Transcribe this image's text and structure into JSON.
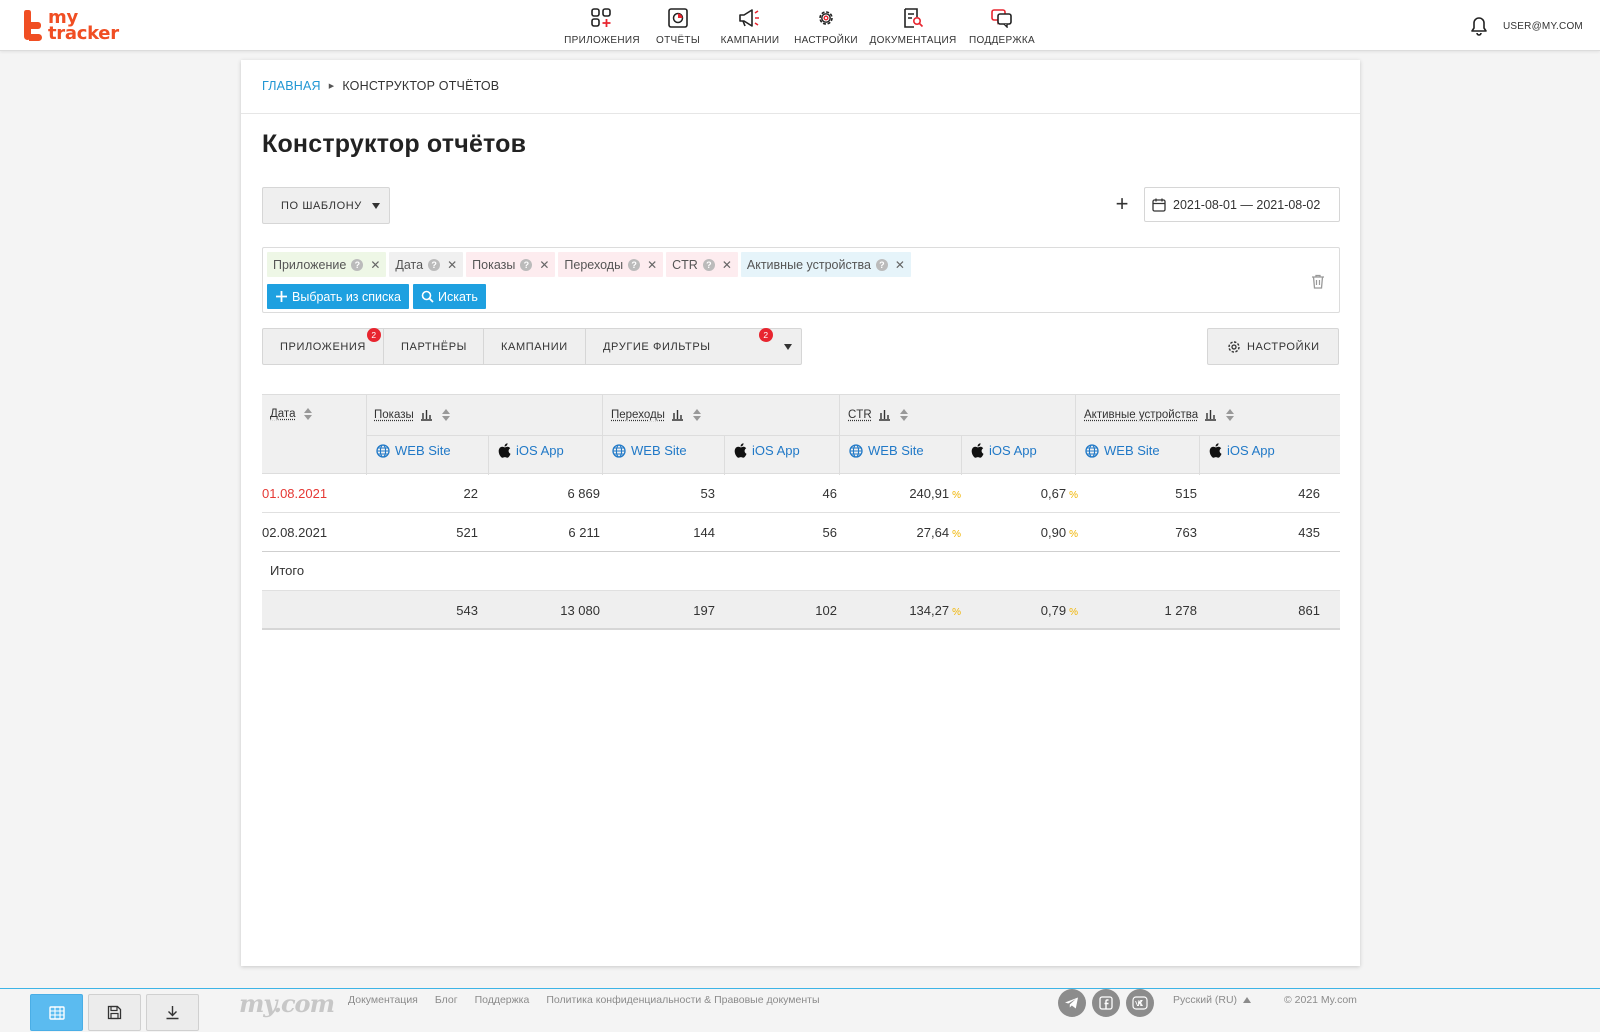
{
  "brand": {
    "line1": "my",
    "line2": "tracker"
  },
  "nav": [
    {
      "label": "ПРИЛОЖЕНИЯ",
      "icon": "apps-icon"
    },
    {
      "label": "ОТЧЁТЫ",
      "icon": "reports-icon"
    },
    {
      "label": "КАМПАНИИ",
      "icon": "megaphone-icon"
    },
    {
      "label": "НАСТРОЙКИ",
      "icon": "gear-icon"
    },
    {
      "label": "ДОКУМЕНТАЦИЯ",
      "icon": "document-search-icon"
    },
    {
      "label": "ПОДДЕРЖКА",
      "icon": "chat-icon"
    }
  ],
  "user": {
    "email": "USER@MY.COM"
  },
  "breadcrumb": {
    "home": "ГЛАВНАЯ",
    "current": "КОНСТРУКТОР ОТЧЁТОВ"
  },
  "page": {
    "title": "Конструктор отчётов"
  },
  "template_button": {
    "label": "ПО ШАБЛОНУ"
  },
  "date_range": {
    "value": "2021-08-01 — 2021-08-02"
  },
  "metrics": {
    "chips": [
      {
        "label": "Приложение",
        "color": "#eef7e6"
      },
      {
        "label": "Дата",
        "color": "#f0f0f0"
      },
      {
        "label": "Показы",
        "color": "#fdecef"
      },
      {
        "label": "Переходы",
        "color": "#fdecef"
      },
      {
        "label": "CTR",
        "color": "#fdecef"
      },
      {
        "label": "Активные устройства",
        "color": "#e6f4fa"
      }
    ],
    "choose_label": "Выбрать из списка",
    "search_label": "Искать"
  },
  "filters": [
    {
      "label": "ПРИЛОЖЕНИЯ",
      "badge": "2"
    },
    {
      "label": "ПАРТНЁРЫ",
      "badge": ""
    },
    {
      "label": "КАМПАНИИ",
      "badge": ""
    },
    {
      "label": "ДРУГИЕ ФИЛЬТРЫ",
      "badge": "2"
    }
  ],
  "settings_button": {
    "label": "НАСТРОЙКИ"
  },
  "table": {
    "date_header": "Дата",
    "groups": [
      "Показы",
      "Переходы",
      "CTR",
      "Активные устройства"
    ],
    "subcolumns": [
      "WEB Site",
      "iOS App"
    ],
    "percent_sign": "%",
    "rows": [
      {
        "date": "01.08.2021",
        "highlight": true,
        "values": [
          "22",
          "6 869",
          "53",
          "46",
          "240,91",
          "0,67",
          "515",
          "426"
        ]
      },
      {
        "date": "02.08.2021",
        "highlight": false,
        "values": [
          "521",
          "6 211",
          "144",
          "56",
          "27,64",
          "0,90",
          "763",
          "435"
        ]
      }
    ],
    "total_label": "Итого",
    "totals": [
      "543",
      "13 080",
      "197",
      "102",
      "134,27",
      "0,79",
      "1 278",
      "861"
    ]
  },
  "footer": {
    "logo": "my.com",
    "links": [
      "Документация",
      "Блог",
      "Поддержка",
      "Политика конфиденциальности & Правовые документы"
    ],
    "social": [
      "telegram-icon",
      "facebook-icon",
      "vk-icon"
    ],
    "language": "Русский (RU)",
    "copyright": "© 2021 My.com"
  },
  "colors": {
    "accent": "#f04e23",
    "link": "#2196d3",
    "primary_button": "#1ea0e0",
    "badge": "#e8252f",
    "highlight_date": "#e53935",
    "percent": "#f0b400"
  }
}
